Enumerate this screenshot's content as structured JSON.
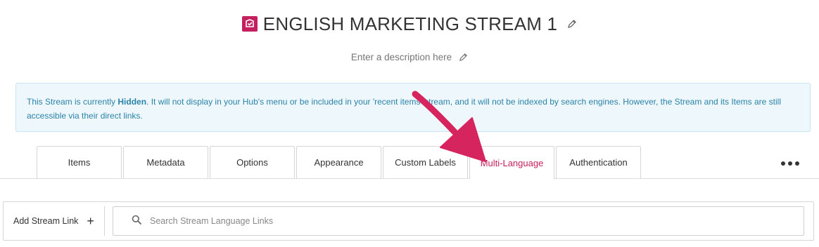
{
  "header": {
    "title": "ENGLISH MARKETING STREAM 1",
    "description_placeholder": "Enter a description here"
  },
  "notice": {
    "prefix": "This Stream is currently ",
    "status": "Hidden",
    "suffix": ". It will not display in your Hub's menu or be included in your 'recent items' stream, and it will not be indexed by search engines. However, the Stream and its Items are still accessible via their direct links."
  },
  "tabs": [
    {
      "label": "Items"
    },
    {
      "label": "Metadata"
    },
    {
      "label": "Options"
    },
    {
      "label": "Appearance"
    },
    {
      "label": "Custom Labels"
    },
    {
      "label": "Multi-Language",
      "active": true
    },
    {
      "label": "Authentication"
    }
  ],
  "toolbar": {
    "add_label": "Add Stream Link",
    "search_placeholder": "Search Stream Language Links"
  },
  "colors": {
    "accent": "#c41f5f",
    "notice_bg": "#eef7fb",
    "notice_text": "#2a83a8",
    "arrow": "#d6245f"
  },
  "icons": [
    "stream-icon",
    "pencil-icon",
    "more-icon",
    "plus-icon",
    "search-icon",
    "annotation-arrow"
  ]
}
